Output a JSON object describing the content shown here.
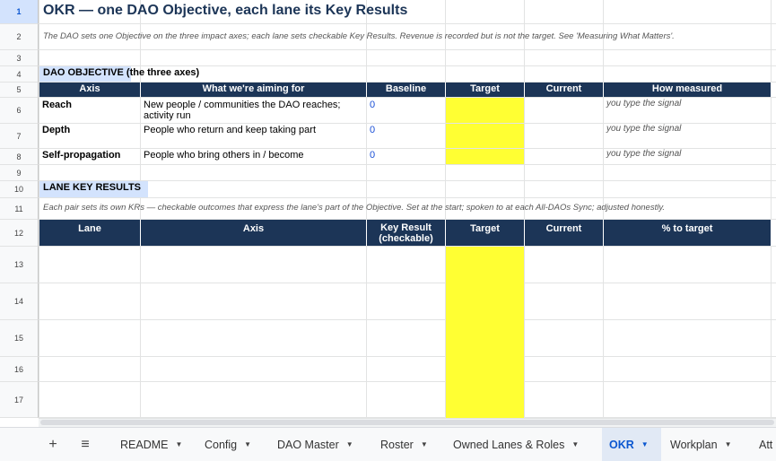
{
  "rows": [
    "1",
    "2",
    "3",
    "4",
    "5",
    "6",
    "7",
    "8",
    "9",
    "10",
    "11",
    "12",
    "13",
    "14",
    "15",
    "16",
    "17"
  ],
  "title": "OKR — one DAO Objective, each lane its Key Results",
  "intro_note": "The DAO sets one Objective on the three impact axes; each lane sets checkable Key Results. Revenue is recorded but is not the target. See 'Measuring What Matters'.",
  "objective_section": "DAO OBJECTIVE (the three axes)",
  "objective_headers": [
    "Axis",
    "What we're aiming for",
    "Baseline",
    "Target",
    "Current",
    "How measured"
  ],
  "objective_rows": [
    {
      "axis": "Reach",
      "aim": "New people / communities the DAO reaches; activity run",
      "baseline": "0",
      "how": "you type the signal"
    },
    {
      "axis": "Depth",
      "aim": "People who return and keep taking part",
      "baseline": "0",
      "how": "you type the signal"
    },
    {
      "axis": "Self-propagation",
      "aim": "People who bring others in / become",
      "baseline": "0",
      "how": "you type the signal"
    }
  ],
  "lane_section": "LANE KEY RESULTS",
  "lane_note": "Each pair sets its own KRs — checkable outcomes that express the lane's part of the Objective. Set at the start; spoken to at each All-DAOs Sync; adjusted honestly.",
  "lane_headers": [
    "Lane",
    "Axis",
    "Key Result (checkable)",
    "Target",
    "Current",
    "% to target"
  ],
  "colors": {
    "header_bg": "#1c3557",
    "target_fill": "#ffff33",
    "active_tab_bg": "#e1e9f5",
    "active_tab_text": "#0b57d0"
  },
  "tabbar": {
    "add_icon": "+",
    "menu_icon": "≡",
    "tabs": [
      "README",
      "Config",
      "DAO Master",
      "Roster",
      "Owned Lanes & Roles",
      "OKR",
      "Workplan",
      "Att"
    ],
    "active": "OKR"
  }
}
